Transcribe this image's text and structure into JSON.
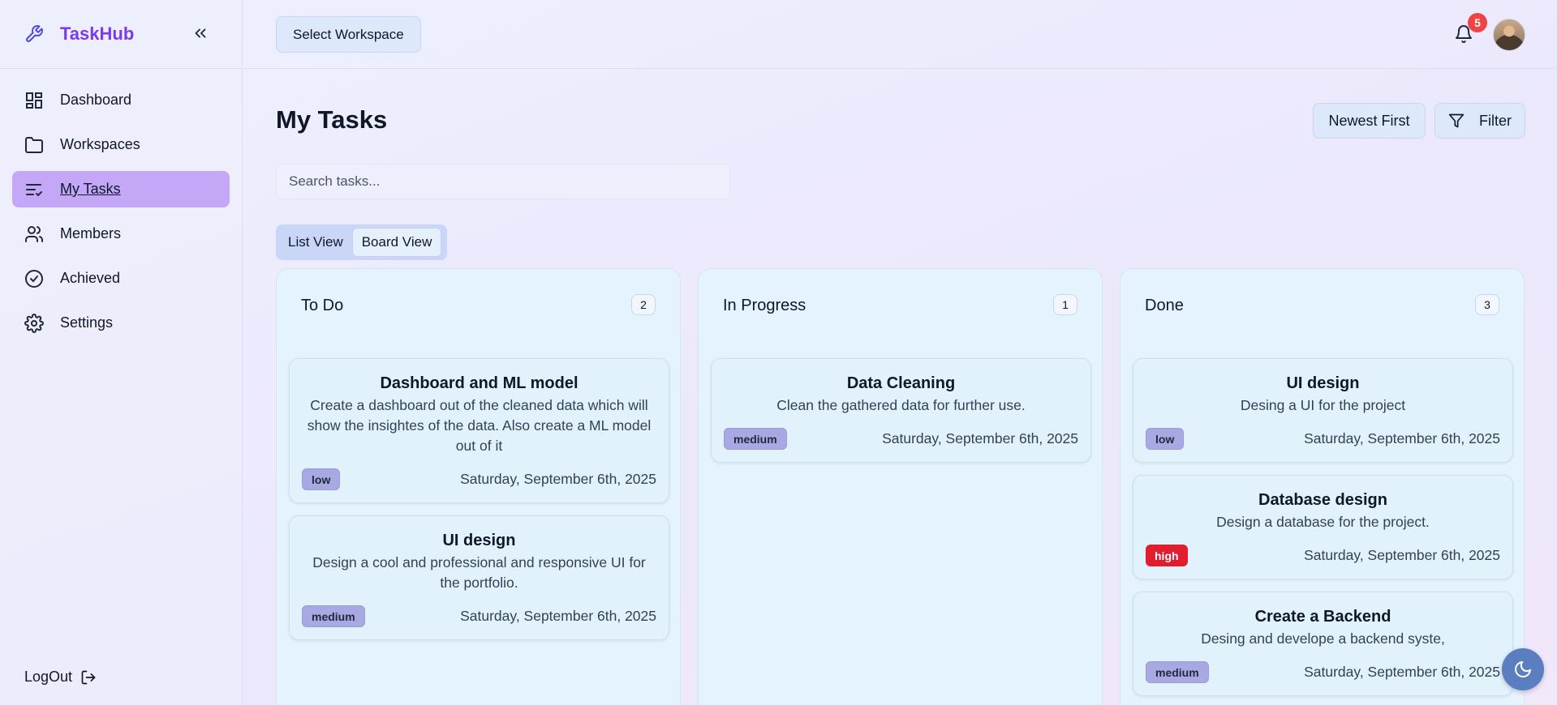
{
  "app": {
    "name": "TaskHub"
  },
  "sidebar": {
    "items": [
      {
        "label": "Dashboard",
        "icon": "dashboard-icon"
      },
      {
        "label": "Workspaces",
        "icon": "folder-icon"
      },
      {
        "label": "My Tasks",
        "icon": "list-check-icon",
        "active": true
      },
      {
        "label": "Members",
        "icon": "users-icon"
      },
      {
        "label": "Achieved",
        "icon": "check-circle-icon"
      },
      {
        "label": "Settings",
        "icon": "gear-icon"
      }
    ],
    "logout_label": "LogOut"
  },
  "header": {
    "workspace_button": "Select Workspace",
    "notification_count": "5"
  },
  "main": {
    "title": "My Tasks",
    "sort_label": "Newest First",
    "filter_label": "Filter",
    "search_placeholder": "Search tasks...",
    "views": [
      "List View",
      "Board View"
    ],
    "selected_view": "Board View"
  },
  "columns": [
    {
      "title": "To Do",
      "count": "2",
      "cards": [
        {
          "title": "Dashboard and ML model",
          "description": "Create a dashboard out of the cleaned data which will show the insightes of the data. Also create a ML model out of it",
          "priority": "low",
          "date": "Saturday, September 6th, 2025"
        },
        {
          "title": "UI design",
          "description": "Design a cool and professional and responsive UI for the portfolio.",
          "priority": "medium",
          "date": "Saturday, September 6th, 2025"
        }
      ]
    },
    {
      "title": "In Progress",
      "count": "1",
      "cards": [
        {
          "title": "Data Cleaning",
          "description": "Clean the gathered data for further use.",
          "priority": "medium",
          "date": "Saturday, September 6th, 2025"
        }
      ]
    },
    {
      "title": "Done",
      "count": "3",
      "cards": [
        {
          "title": "UI design",
          "description": "Desing a UI for the project",
          "priority": "low",
          "date": "Saturday, September 6th, 2025"
        },
        {
          "title": "Database design",
          "description": "Design a database for the project.",
          "priority": "high",
          "date": "Saturday, September 6th, 2025"
        },
        {
          "title": "Create a Backend",
          "description": "Desing and develope a backend syste,",
          "priority": "medium",
          "date": "Saturday, September 6th, 2025"
        }
      ]
    }
  ],
  "colors": {
    "brand": "#7c3aed",
    "active_nav": "#c4a7f6",
    "priority_high": "#e11d2e",
    "priority_low_medium": "#a8a8e2",
    "notification_badge": "#ef4444"
  }
}
